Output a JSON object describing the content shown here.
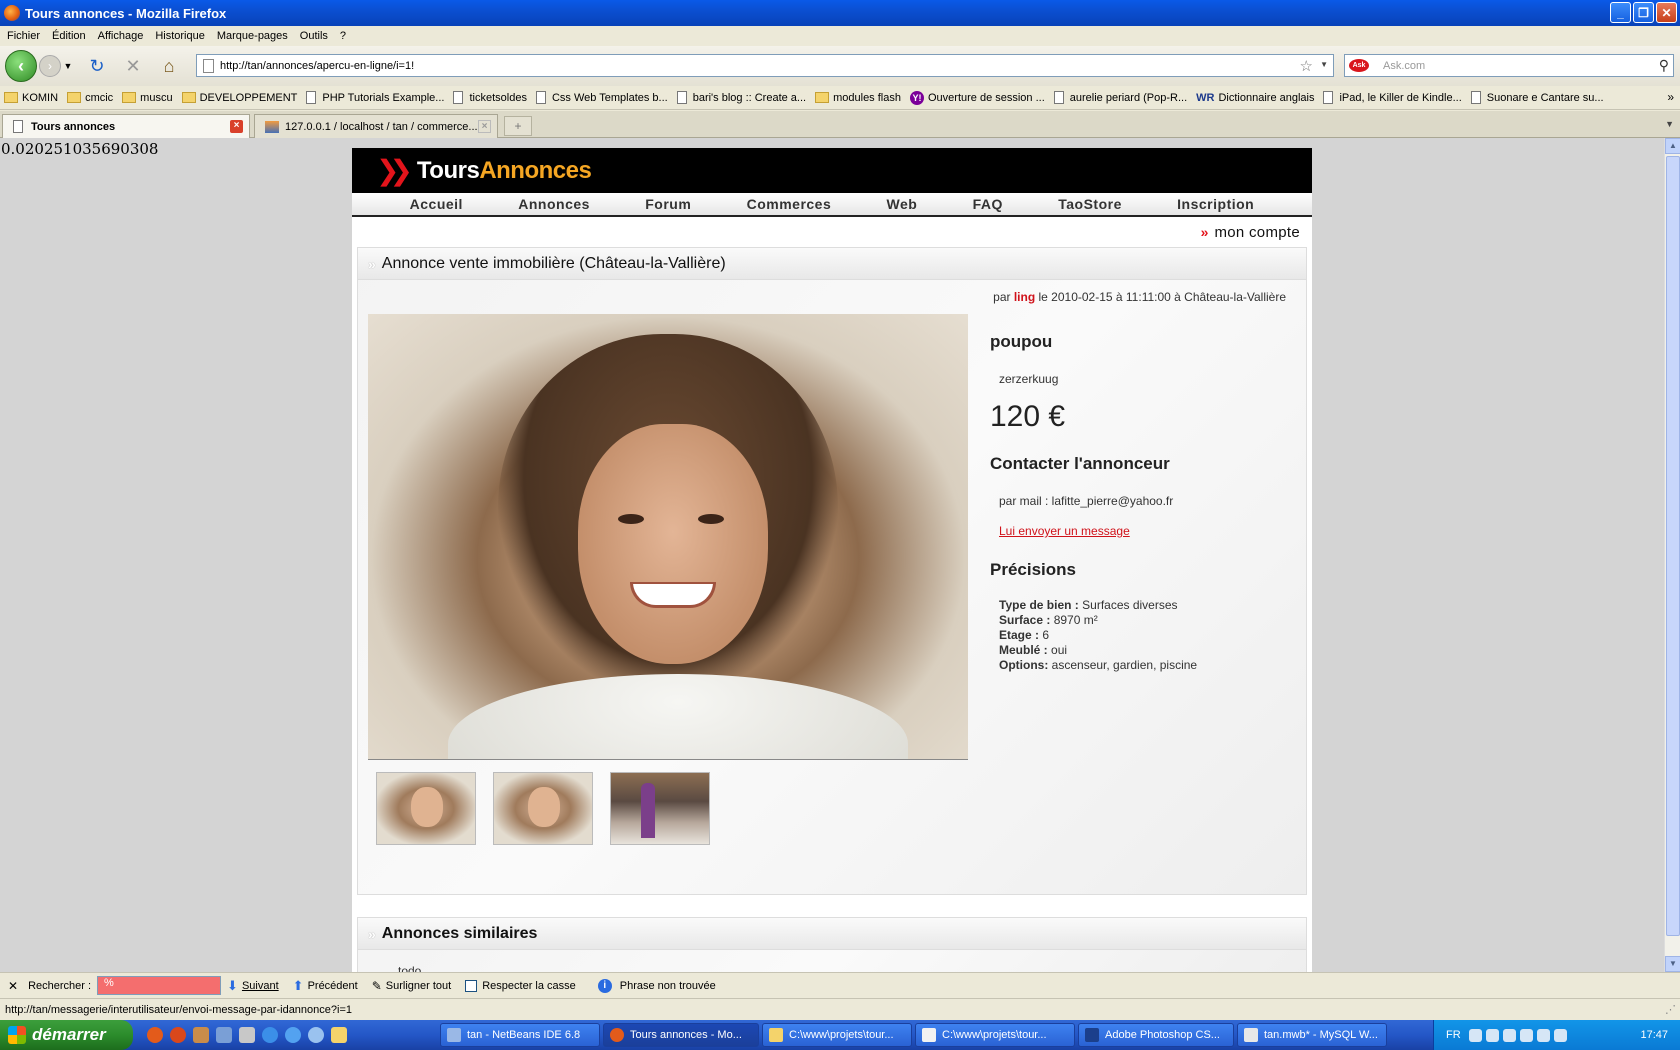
{
  "window": {
    "title": "Tours annonces - Mozilla Firefox",
    "buttons": {
      "minimize": "_",
      "maximize": "❐",
      "close": "✕"
    }
  },
  "menubar": [
    "Fichier",
    "Édition",
    "Affichage",
    "Historique",
    "Marque-pages",
    "Outils",
    "?"
  ],
  "navbar": {
    "url": "http://tan/annonces/apercu-en-ligne/i=1!",
    "search_placeholder": "Ask.com",
    "search_logo": "Ask"
  },
  "bookmarks": [
    {
      "label": "KOMIN",
      "icon": "folder-icon"
    },
    {
      "label": "cmcic",
      "icon": "folder-icon"
    },
    {
      "label": "muscu",
      "icon": "folder-icon"
    },
    {
      "label": "DEVELOPPEMENT",
      "icon": "folder-icon"
    },
    {
      "label": "PHP Tutorials Example...",
      "icon": "page-icon"
    },
    {
      "label": "ticketsoldes",
      "icon": "page-icon"
    },
    {
      "label": "Css Web Templates b...",
      "icon": "page-icon"
    },
    {
      "label": "bari's blog :: Create a...",
      "icon": "page-icon"
    },
    {
      "label": "modules flash",
      "icon": "folder-icon"
    },
    {
      "label": "Ouverture de session ...",
      "icon": "yahoo-icon"
    },
    {
      "label": "aurelie periard (Pop-R...",
      "icon": "page-icon"
    },
    {
      "label": "Dictionnaire anglais",
      "icon": "wordreference-icon"
    },
    {
      "label": "iPad, le Killer de Kindle...",
      "icon": "page-icon"
    },
    {
      "label": "Suonare e Cantare su...",
      "icon": "page-icon"
    }
  ],
  "tabs": [
    {
      "label": "Tours annonces",
      "active": true
    },
    {
      "label": "127.0.0.1 / localhost / tan / commerce...",
      "active": false
    }
  ],
  "debug_number": "0.020251035690308",
  "site": {
    "logo_part1": "Tours",
    "logo_part2": "Annonces",
    "nav": [
      "Accueil",
      "Annonces",
      "Forum",
      "Commerces",
      "Web",
      "FAQ",
      "TaoStore",
      "Inscription"
    ],
    "account_link": "mon compte",
    "listing": {
      "heading": "Annonce vente immobilière (Château-la-Vallière)",
      "meta_prefix": "par",
      "meta_user": "ling",
      "meta_suffix": "le 2010-02-15 à 11:11:00 à Château-la-Vallière",
      "title": "poupou",
      "subtitle": "zerzerkuug",
      "price": "120 €",
      "contact_heading": "Contacter l'annonceur",
      "contact_mail": "par mail : lafitte_pierre@yahoo.fr",
      "contact_link": "Lui envoyer un message",
      "details_heading": "Précisions",
      "details": [
        {
          "label": "Type de bien :",
          "value": "Surfaces diverses"
        },
        {
          "label": "Surface :",
          "value": "8970 m²"
        },
        {
          "label": "Etage :",
          "value": "6"
        },
        {
          "label": "Meublé :",
          "value": "oui"
        },
        {
          "label": "Options:",
          "value": "ascenseur, gardien, piscine"
        }
      ]
    },
    "similar": {
      "heading": "Annonces similaires",
      "body": "todo"
    }
  },
  "findbar": {
    "label": "Rechercher :",
    "value": "%",
    "next": "Suivant",
    "previous": "Précédent",
    "highlight": "Surligner tout",
    "match_case": "Respecter la casse",
    "status": "Phrase non trouvée"
  },
  "statusbar": {
    "text": "http://tan/messagerie/interutilisateur/envoi-message-par-idannonce?i=1"
  },
  "taskbar": {
    "start": "démarrer",
    "items": [
      {
        "label": "tan - NetBeans IDE 6.8",
        "active": false
      },
      {
        "label": "Tours annonces - Mo...",
        "active": true
      },
      {
        "label": "C:\\www\\projets\\tour...",
        "active": false
      },
      {
        "label": "C:\\www\\projets\\tour...",
        "active": false
      },
      {
        "label": "Adobe Photoshop CS...",
        "active": false
      },
      {
        "label": "tan.mwb* - MySQL W...",
        "active": false
      }
    ],
    "lang": "FR",
    "clock": "17:47"
  }
}
